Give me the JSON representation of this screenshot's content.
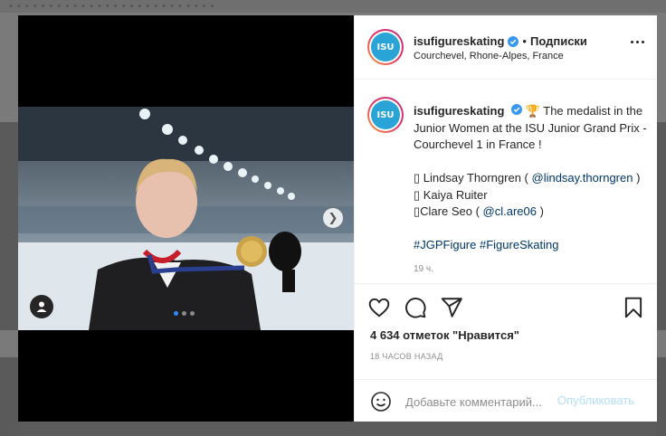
{
  "background": {
    "top_text": "• • • • • • • • • • • • • • • • • • • • • • • • • •"
  },
  "post": {
    "username": "isufigureskating",
    "follow_label": "Подписки",
    "dot": "•",
    "location": "Courchevel, Rhone-Alpes, France",
    "avatar_text": "ISU",
    "caption": {
      "username": "isufigureskating",
      "trophy": "🏆",
      "text_1": "The medalist in the Junior Women at the ISU Junior Grand Prix - Courchevel 1 in France !",
      "medal_1_prefix": "▯ Lindsay Thorngren (",
      "medal_1_mention": "@lindsay.thorngren",
      "medal_1_suffix": ")",
      "medal_2": "▯ Kaiya Ruiter",
      "medal_3_prefix": "▯Clare Seo (",
      "medal_3_mention": "@cl.are06",
      "medal_3_suffix": ")",
      "hashtag_1": "#JGPFigure",
      "hashtag_2": "#FigureSkating",
      "meta": "19 ч."
    },
    "likes": "4 634 отметок \"Нравится\"",
    "time_ago": "18 ЧАСОВ НАЗАД",
    "comment_placeholder": "Добавьте комментарий...",
    "publish_label": "Опубликовать",
    "carousel": {
      "count": 3,
      "active_index": 0
    },
    "next_glyph": "❯"
  },
  "colors": {
    "verified": "#3897f0",
    "link": "#00376b",
    "publish_disabled": "#b2dffc",
    "carousel_active": "#2f8cff"
  },
  "icons": [
    "verified-badge-icon",
    "more-options-icon",
    "heart-icon",
    "comment-icon",
    "share-icon",
    "bookmark-icon",
    "emoji-icon",
    "user-tag-icon",
    "chevron-right-icon"
  ]
}
